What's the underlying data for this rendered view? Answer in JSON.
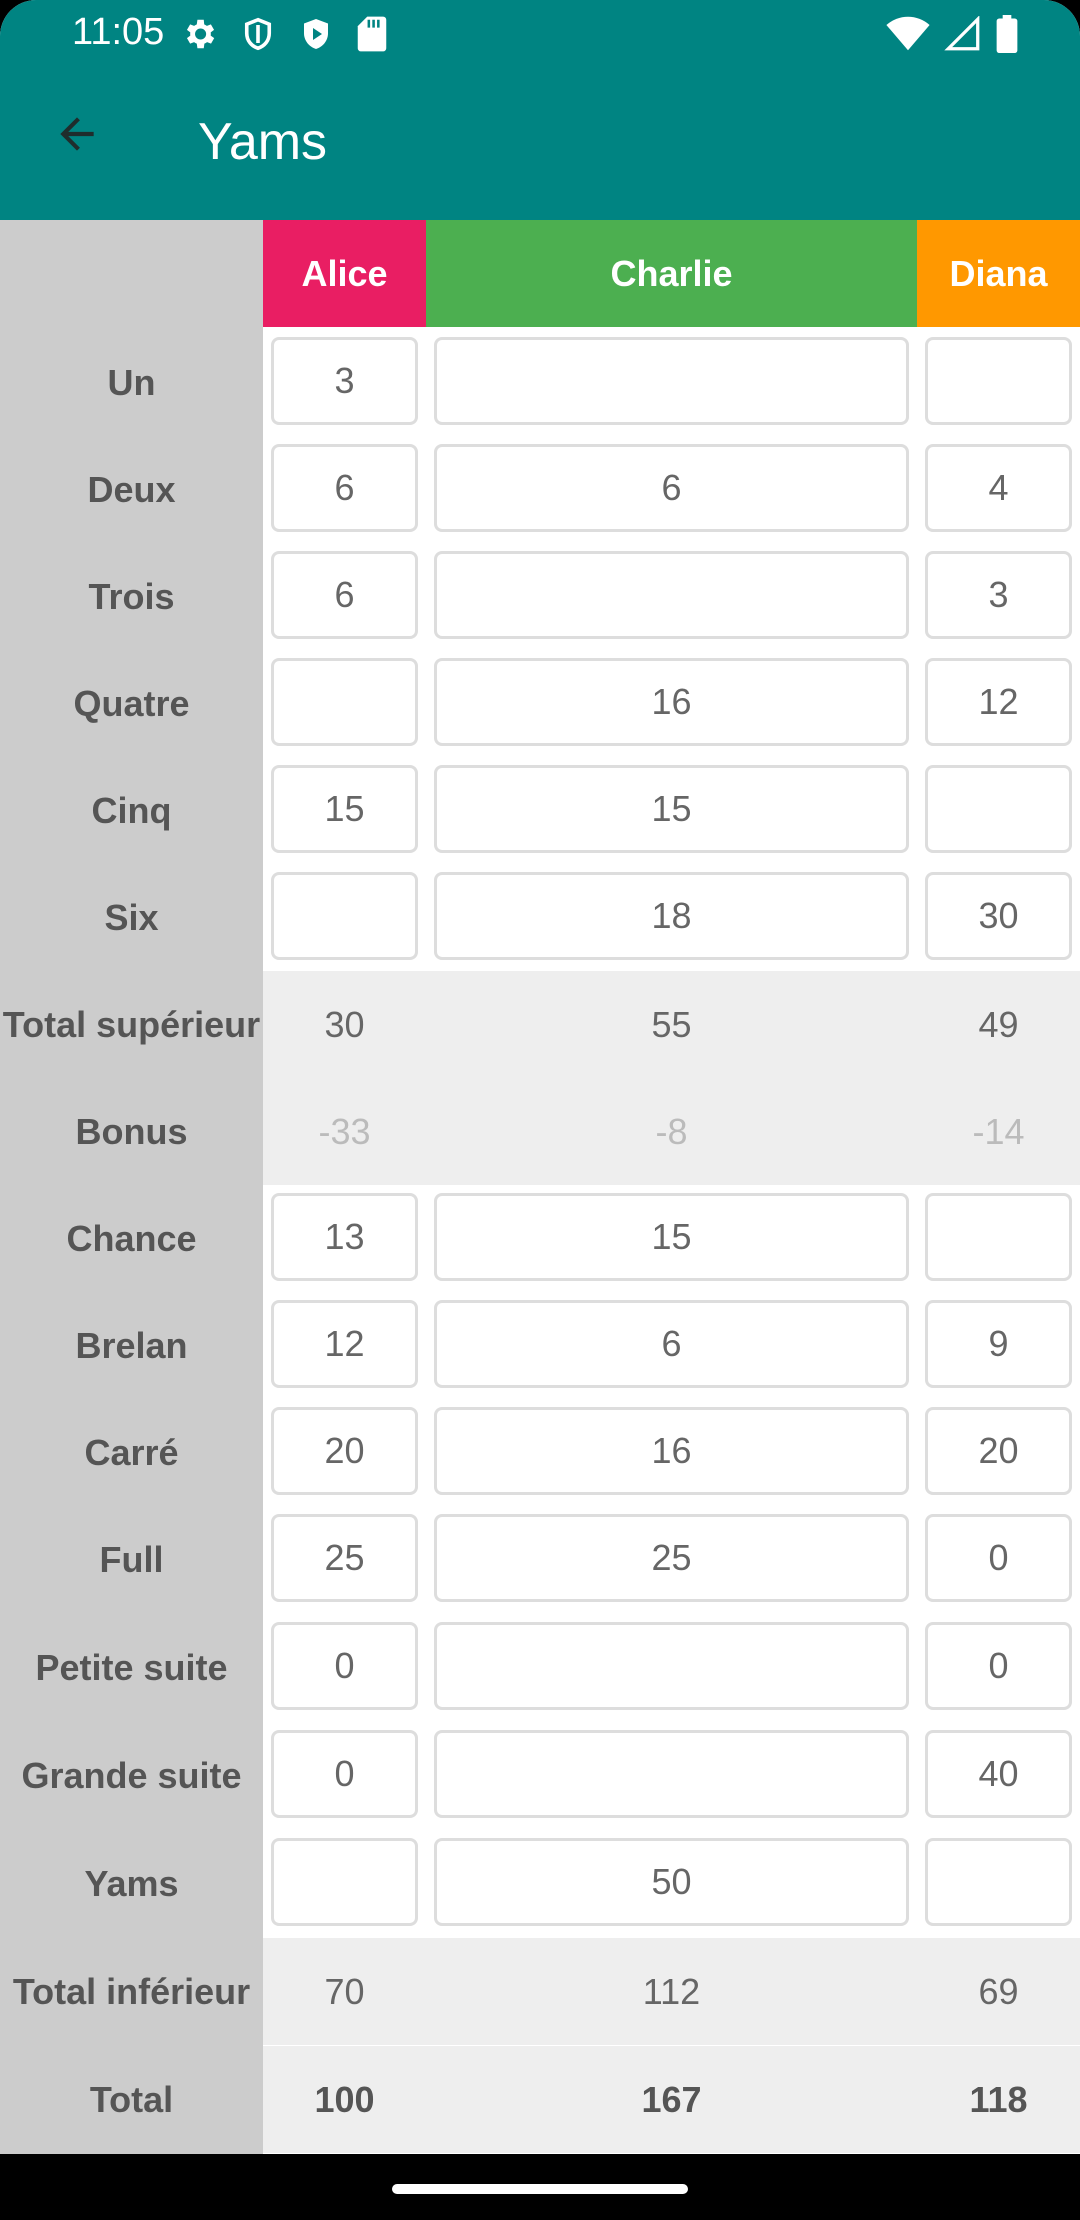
{
  "status_bar": {
    "time": "11:05",
    "icons_left": [
      "gear-icon",
      "shield-icon",
      "play-protect-icon",
      "sd-card-icon"
    ],
    "icons_right": [
      "wifi-icon",
      "cell-signal-icon",
      "battery-icon"
    ]
  },
  "app_bar": {
    "title": "Yams",
    "back_icon": "arrow-left-icon"
  },
  "colors": {
    "primary": "#008482",
    "alice": "#e91e63",
    "charlie": "#4caf50",
    "diana": "#ff9800"
  },
  "players": [
    {
      "name": "Alice",
      "color": "#e91e63"
    },
    {
      "name": "Charlie",
      "color": "#4caf50"
    },
    {
      "name": "Diana",
      "color": "#ff9800"
    }
  ],
  "rows": [
    {
      "label": "Un",
      "kind": "input",
      "values": [
        "3",
        "",
        ""
      ]
    },
    {
      "label": "Deux",
      "kind": "input",
      "values": [
        "6",
        "6",
        "4"
      ]
    },
    {
      "label": "Trois",
      "kind": "input",
      "values": [
        "6",
        "",
        "3"
      ]
    },
    {
      "label": "Quatre",
      "kind": "input",
      "values": [
        "",
        "16",
        "12"
      ]
    },
    {
      "label": "Cinq",
      "kind": "input",
      "values": [
        "15",
        "15",
        ""
      ]
    },
    {
      "label": "Six",
      "kind": "input",
      "values": [
        "",
        "18",
        "30"
      ]
    },
    {
      "label": "Total supérieur",
      "kind": "total",
      "values": [
        "30",
        "55",
        "49"
      ]
    },
    {
      "label": "Bonus",
      "kind": "bonus",
      "values": [
        "-33",
        "-8",
        "-14"
      ]
    },
    {
      "label": "Chance",
      "kind": "input",
      "values": [
        "13",
        "15",
        ""
      ]
    },
    {
      "label": "Brelan",
      "kind": "input",
      "values": [
        "12",
        "6",
        "9"
      ]
    },
    {
      "label": "Carré",
      "kind": "input",
      "values": [
        "20",
        "16",
        "20"
      ]
    },
    {
      "label": "Full",
      "kind": "input",
      "values": [
        "25",
        "25",
        "0"
      ]
    },
    {
      "label": "Petite suite",
      "kind": "input",
      "values": [
        "0",
        "",
        "0"
      ]
    },
    {
      "label": "Grande suite",
      "kind": "input",
      "values": [
        "0",
        "",
        "40"
      ]
    },
    {
      "label": "Yams",
      "kind": "input",
      "values": [
        "",
        "50",
        ""
      ]
    },
    {
      "label": "Total inférieur",
      "kind": "total",
      "values": [
        "70",
        "112",
        "69"
      ]
    },
    {
      "label": "Total",
      "kind": "grand",
      "values": [
        "100",
        "167",
        "118"
      ]
    }
  ]
}
